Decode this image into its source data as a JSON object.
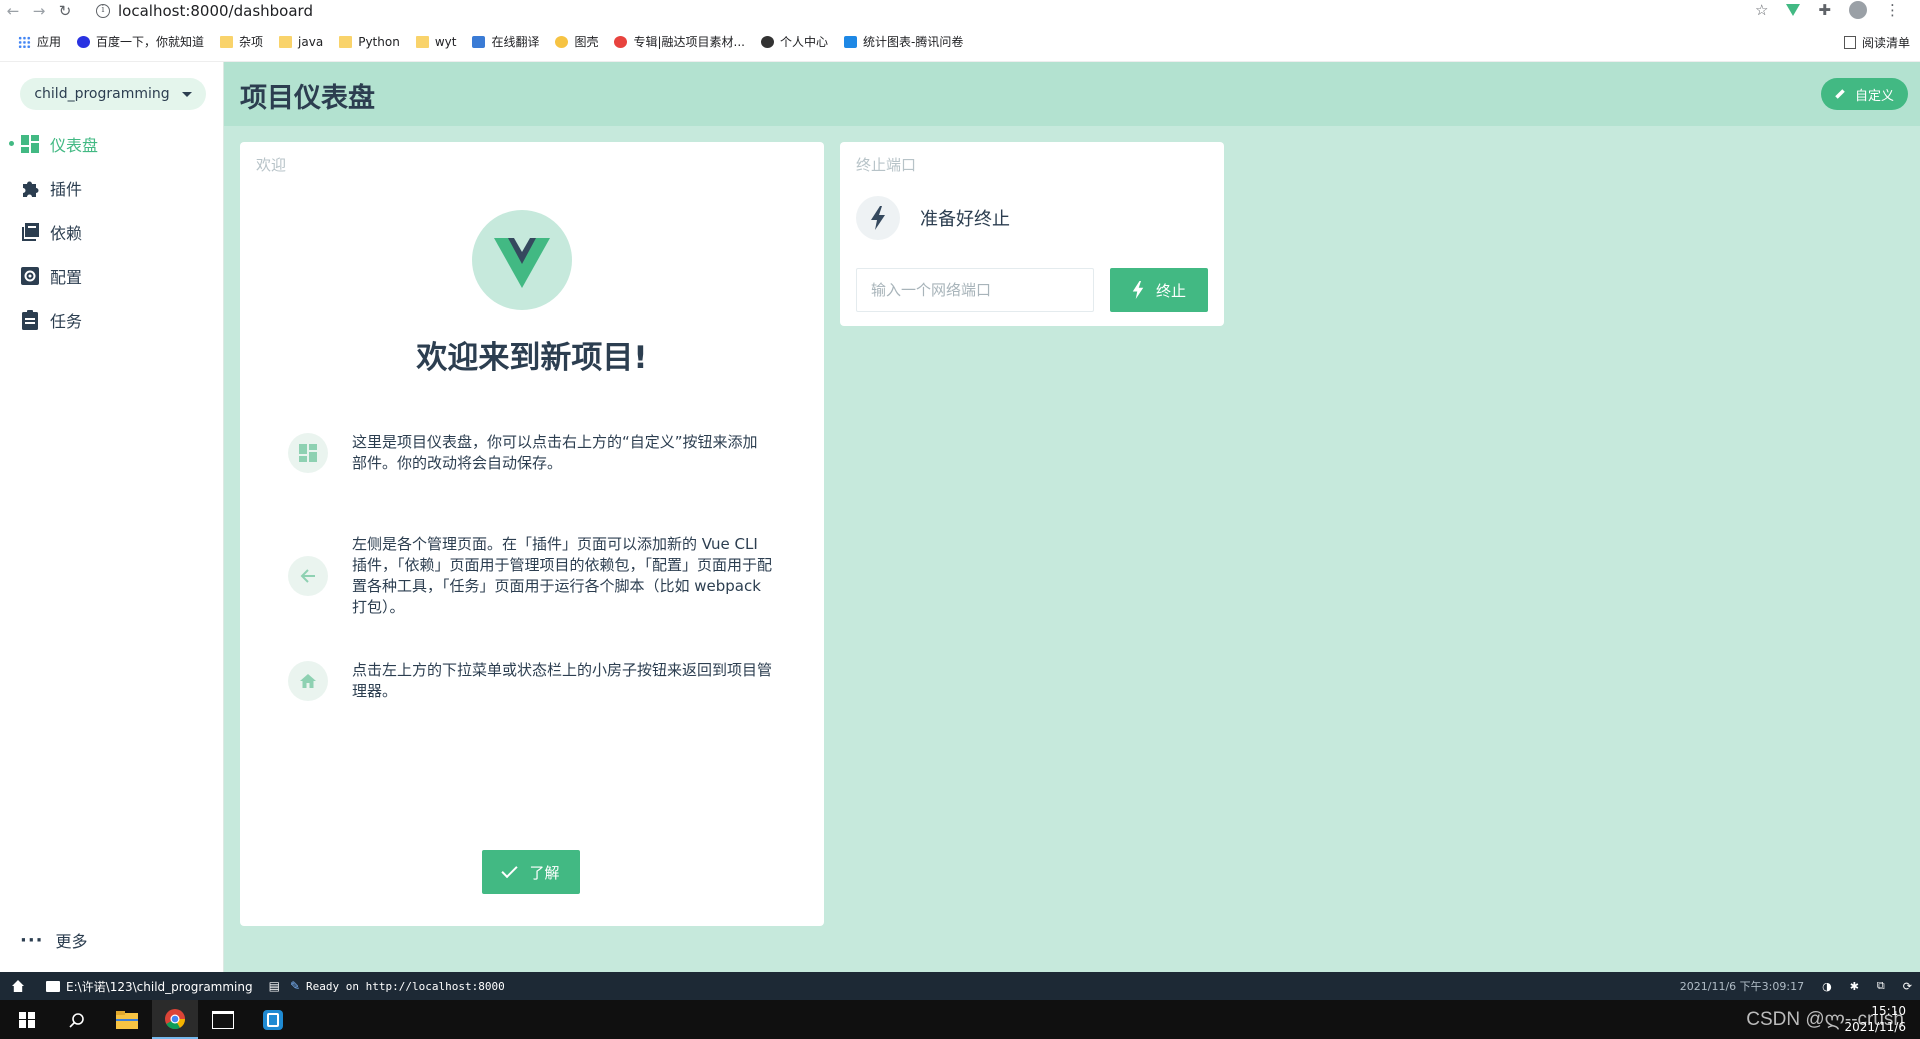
{
  "browser": {
    "url": "localhost:8000/dashboard",
    "bookmarks": [
      "应用",
      "百度一下，你就知道",
      "杂项",
      "java",
      "Python",
      "wyt",
      "在线翻译",
      "图壳",
      "专辑|融达项目素材...",
      "个人中心",
      "统计图表-腾讯问卷"
    ],
    "reading_list": "阅读清单"
  },
  "sidebar": {
    "project_name": "child_programming",
    "items": [
      {
        "label": "仪表盘",
        "icon": "dashboard-icon",
        "active": true
      },
      {
        "label": "插件",
        "icon": "puzzle-icon",
        "active": false
      },
      {
        "label": "依赖",
        "icon": "library-icon",
        "active": false
      },
      {
        "label": "配置",
        "icon": "gear-icon",
        "active": false
      },
      {
        "label": "任务",
        "icon": "clipboard-icon",
        "active": false
      }
    ],
    "more_label": "更多"
  },
  "header": {
    "title": "项目仪表盘",
    "customize_label": "自定义"
  },
  "welcome": {
    "card_title": "欢迎",
    "heading": "欢迎来到新项目!",
    "tips": [
      {
        "icon": "dashboard-icon",
        "text": "这里是项目仪表盘，你可以点击右上方的“自定义”按钮来添加部件。你的改动将会自动保存。"
      },
      {
        "icon": "arrow-left-icon",
        "text": "左侧是各个管理页面。在「插件」页面可以添加新的 Vue CLI 插件，「依赖」页面用于管理项目的依赖包，「配置」页面用于配置各种工具，「任务」页面用于运行各个脚本（比如 webpack 打包）。"
      },
      {
        "icon": "home-icon",
        "text": "点击左上方的下拉菜单或状态栏上的小房子按钮来返回到项目管理器。"
      }
    ],
    "ok_label": "了解"
  },
  "kill_port": {
    "card_title": "终止端口",
    "status": "准备好终止",
    "input_placeholder": "输入一个网络端口",
    "button_label": "终止"
  },
  "statusbar": {
    "path": "E:\\许诺\\123\\child_programming",
    "log": "Ready on http://localhost:8000",
    "datetime": "2021/11/6 下午3:09:17"
  },
  "taskbar": {
    "time": "15:10",
    "date": "2021/11/6",
    "watermark": "CSDN @ლ--crush"
  },
  "colors": {
    "accent": "#42b983",
    "main_bg": "#c6e9dc",
    "header_bg": "#b3e2d0",
    "vue_dark": "#35495e",
    "statusbar_bg": "#1d2935"
  }
}
